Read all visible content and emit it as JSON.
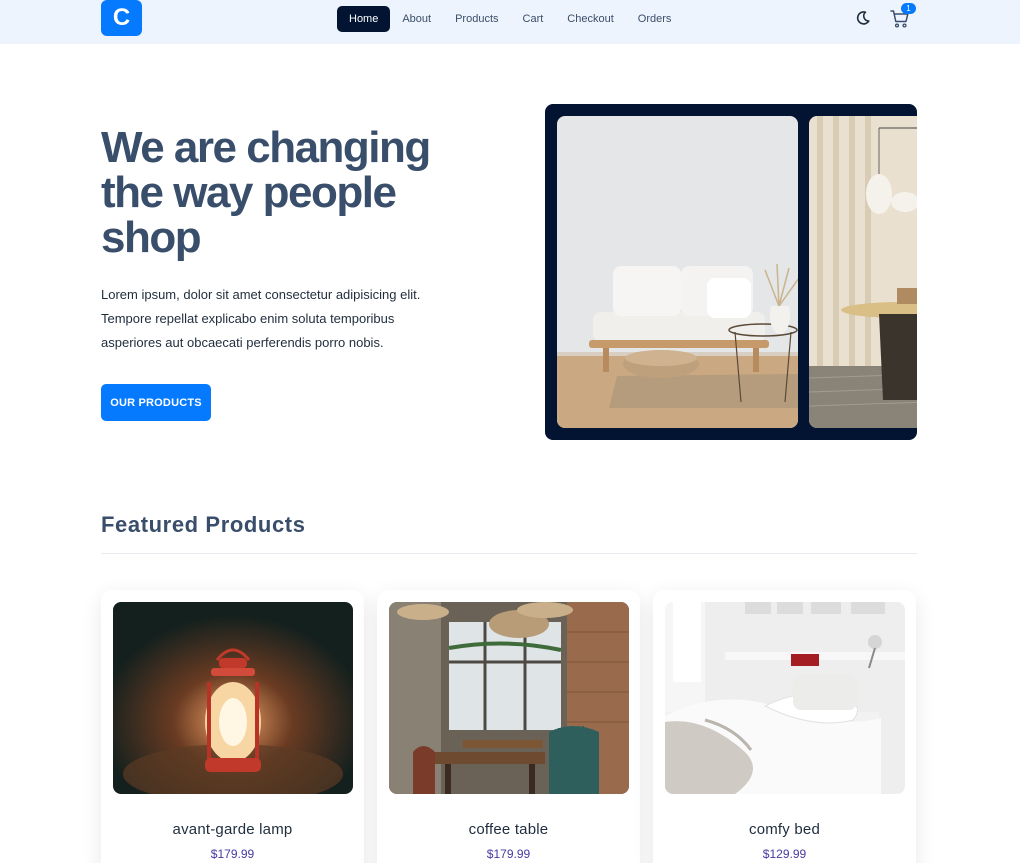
{
  "logo": {
    "letter": "C"
  },
  "nav": {
    "items": [
      {
        "label": "Home",
        "active": true
      },
      {
        "label": "About"
      },
      {
        "label": "Products"
      },
      {
        "label": "Cart"
      },
      {
        "label": "Checkout"
      },
      {
        "label": "Orders"
      }
    ],
    "theme_icon": "moon-icon",
    "cart_icon": "cart-icon",
    "cart_count": "1"
  },
  "hero": {
    "title": "We are changing the way people shop",
    "text": "Lorem ipsum, dolor sit amet consectetur adipisicing elit. Tempore repellat explicabo enim soluta temporibus asperiores aut obcaecati perferendis porro nobis.",
    "button_label": "OUR PRODUCTS"
  },
  "featured": {
    "title": "Featured Products",
    "products": [
      {
        "title": "avant-garde lamp",
        "price": "$179.99"
      },
      {
        "title": "coffee table",
        "price": "$179.99"
      },
      {
        "title": "comfy bed",
        "price": "$129.99"
      }
    ]
  },
  "colors": {
    "primary": "#057aff",
    "nav_bg": "#eef4fd",
    "dark": "#021431",
    "text": "#394e6a",
    "price": "#463aa1"
  }
}
